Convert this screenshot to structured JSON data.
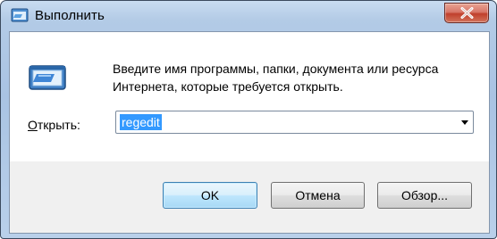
{
  "window": {
    "title": "Выполнить",
    "icon": "run-dialog-icon",
    "close_icon": "close-icon"
  },
  "dialog": {
    "description": "Введите имя программы, папки, документа или ресурса Интернета, которые требуется открыть.",
    "open_label_prefix": "",
    "open_label_accel": "О",
    "open_label_rest": "ткрыть:",
    "input_value": "regedit",
    "dropdown_icon": "chevron-down-icon"
  },
  "buttons": {
    "ok": "OK",
    "cancel": "Отмена",
    "browse": "Обзор..."
  },
  "colors": {
    "selection": "#3399ff",
    "close_button": "#c0402c",
    "title_bar": "#b3cbe6"
  }
}
